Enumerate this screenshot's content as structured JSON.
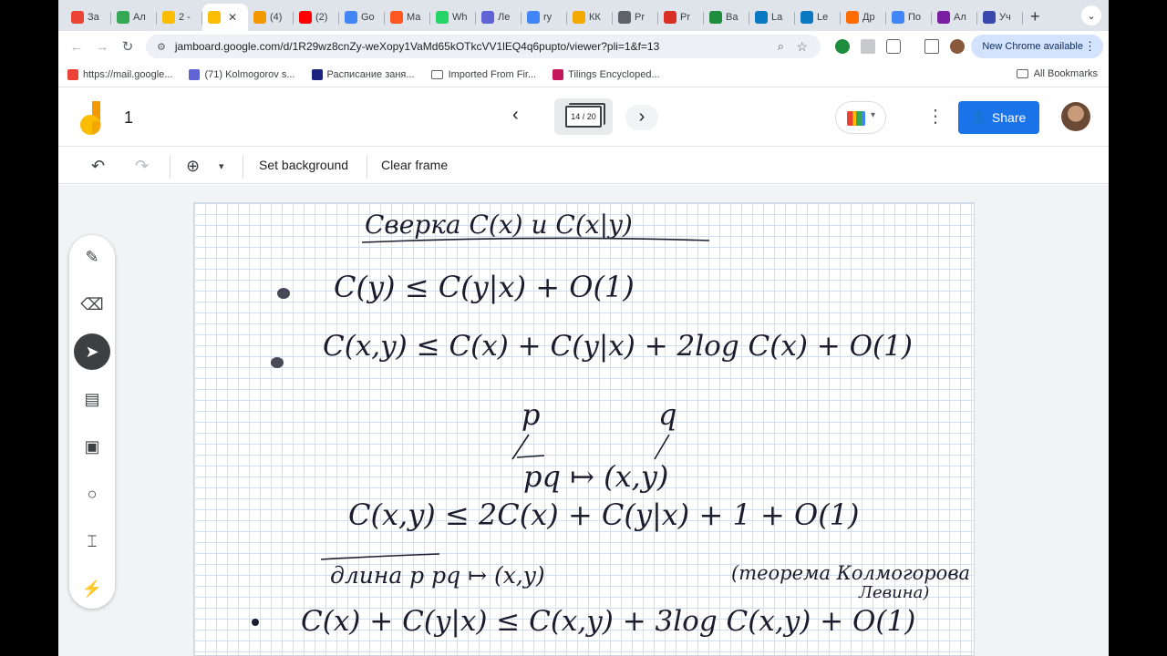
{
  "browser": {
    "tabs": [
      {
        "label": "За",
        "color": "#ea4335"
      },
      {
        "label": "Ал",
        "color": "#34a853"
      },
      {
        "label": "2 -",
        "color": "#fbbc04"
      },
      {
        "label": "",
        "color": "#fbbc04",
        "active": true
      },
      {
        "label": "(4)",
        "color": "#f29900"
      },
      {
        "label": "(2)",
        "color": "#ff0000"
      },
      {
        "label": "Go",
        "color": "#4285f4"
      },
      {
        "label": "Ма",
        "color": "#ff5722"
      },
      {
        "label": "Wh",
        "color": "#25d366"
      },
      {
        "label": "Ле",
        "color": "#5f63d4"
      },
      {
        "label": "ry",
        "color": "#4285f4"
      },
      {
        "label": "КК",
        "color": "#f2a900"
      },
      {
        "label": "Pr",
        "color": "#5f6368"
      },
      {
        "label": "Pr",
        "color": "#d93025"
      },
      {
        "label": "Ва",
        "color": "#1e8e3e"
      },
      {
        "label": "La",
        "color": "#0b79c2"
      },
      {
        "label": "Le",
        "color": "#0b79c2"
      },
      {
        "label": "Др",
        "color": "#ff6d00"
      },
      {
        "label": "По",
        "color": "#4285f4"
      },
      {
        "label": "Ал",
        "color": "#7b1fa2"
      },
      {
        "label": "Уч",
        "color": "#3949ab"
      }
    ],
    "url": "jamboard.google.com/d/1R29wz8cnZy-weXopy1VaMd65kOTkcVV1lEQ4q6pupto/viewer?pli=1&f=13",
    "update_label": "New Chrome available",
    "bookmarks": [
      {
        "label": "https://mail.google...",
        "color": "#ea4335"
      },
      {
        "label": "(71) Kolmogorov s...",
        "color": "#5f63d4"
      },
      {
        "label": "Расписание заня...",
        "color": "#1a237e"
      },
      {
        "label": "Imported From Fir...",
        "color": "folder"
      },
      {
        "label": "Tilings Encycloped...",
        "color": "#c2185b"
      }
    ],
    "all_bookmarks": "All Bookmarks"
  },
  "jamboard": {
    "title": "1",
    "frame_counter": "14 / 20",
    "share_label": "Share",
    "toolbar": {
      "set_background": "Set background",
      "clear_frame": "Clear frame"
    }
  },
  "whiteboard": {
    "lines": [
      "Сверка C(x) и C(x|y)",
      "C(y) ≤ C(y|x) + O(1)",
      "C(x,y) ≤ C(x) + C(y|x) + 2log C(x) + O(1)",
      "p",
      "q",
      "pq ↦ (x,y)",
      "C(x,y) ≤ 2C(x) + C(y|x) + 1 + O(1)",
      "длина p  pq  ↦ (x,y)",
      "(теорема Колмогорова",
      "Левина)",
      "C(x) + C(y|x) ≤ C(x,y) + 3log C(x,y) + O(1)"
    ]
  }
}
